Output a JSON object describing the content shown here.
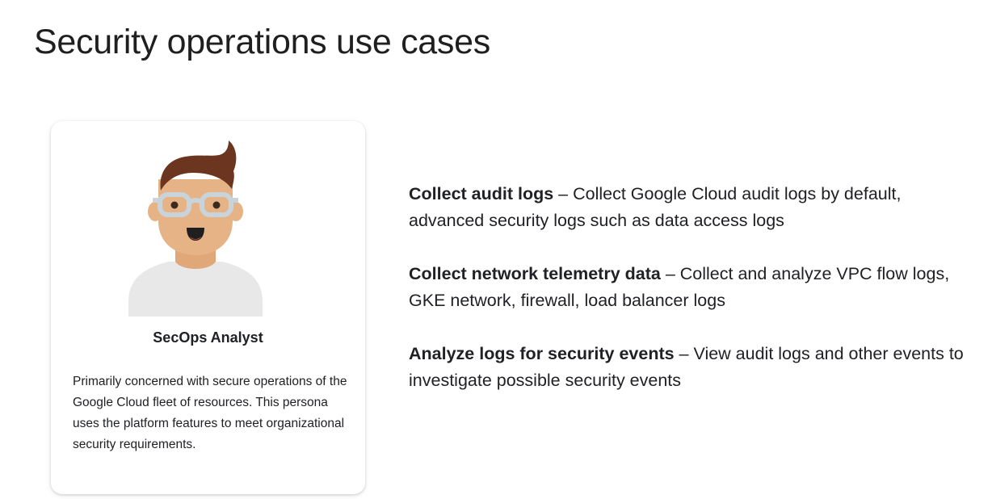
{
  "slide": {
    "title": "Security operations use cases"
  },
  "persona": {
    "name": "SecOps Analyst",
    "description": "Primarily concerned with secure operations of the Google Cloud fleet of resources. This persona uses the platform features to meet organizational security requirements.",
    "avatar_icon": "analyst-avatar-icon",
    "colors": {
      "hair": "#6b3520",
      "skin": "#e6b386",
      "shirt": "#e8e8e8",
      "glasses": "#c9d3da"
    }
  },
  "use_cases": [
    {
      "heading": "Collect audit logs",
      "separator": " – ",
      "text": "Collect Google Cloud audit logs by default, advanced security logs such as data access logs"
    },
    {
      "heading": "Collect network telemetry data",
      "separator": " – ",
      "text": "Collect and analyze VPC flow logs, GKE network, firewall, load balancer logs"
    },
    {
      "heading": "Analyze logs for security events",
      "separator": " – ",
      "text": "View audit logs and other events to investigate possible security events"
    }
  ]
}
